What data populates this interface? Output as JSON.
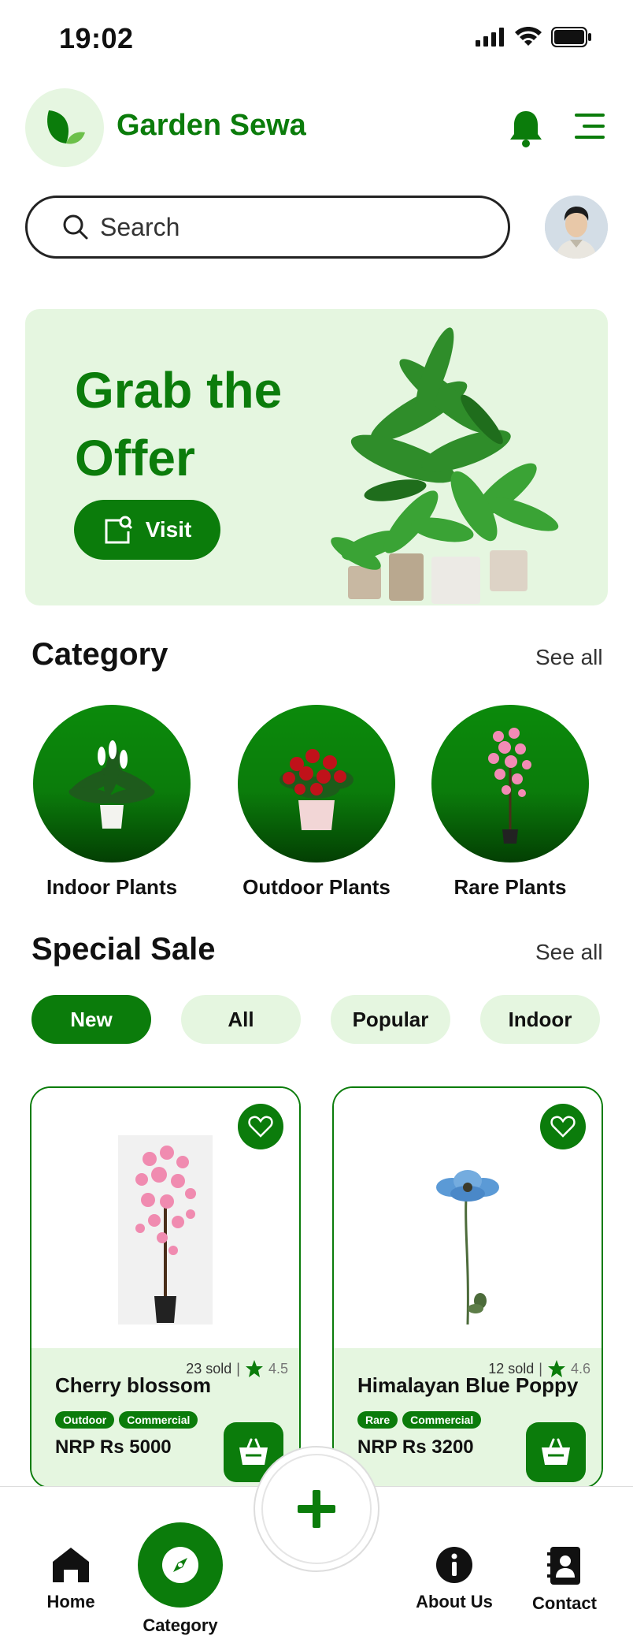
{
  "status_bar": {
    "time": "19:02"
  },
  "header": {
    "brand": "Garden Sewa"
  },
  "search": {
    "placeholder": "Search"
  },
  "banner": {
    "title": "Grab the Offer",
    "button_label": "Visit"
  },
  "category": {
    "title": "Category",
    "see_all": "See all",
    "items": [
      {
        "label": "Indoor Plants"
      },
      {
        "label": "Outdoor Plants"
      },
      {
        "label": "Rare Plants"
      }
    ]
  },
  "special_sale": {
    "title": "Special Sale",
    "see_all": "See all",
    "filters": [
      {
        "label": "New",
        "active": true
      },
      {
        "label": "All",
        "active": false
      },
      {
        "label": "Popular",
        "active": false
      },
      {
        "label": "Indoor",
        "active": false
      }
    ],
    "products": [
      {
        "name": "Cherry blossom",
        "sold": "23 sold",
        "rating": "4.5",
        "tags": [
          "Outdoor",
          "Commercial"
        ],
        "price": "NRP Rs 5000"
      },
      {
        "name": "Himalayan Blue Poppy",
        "sold": "12 sold",
        "rating": "4.6",
        "tags": [
          "Rare",
          "Commercial"
        ],
        "price": "NRP Rs 3200"
      }
    ]
  },
  "bottom_nav": {
    "items": [
      {
        "label": "Home"
      },
      {
        "label": "Category"
      },
      {
        "label": "About Us"
      },
      {
        "label": "Contact"
      }
    ]
  },
  "colors": {
    "brand_green": "#0b7c0b",
    "light_green": "#e5f6e0"
  },
  "icons": [
    "leaf-logo-icon",
    "bell-icon",
    "menu-icon",
    "search-icon",
    "visit-icon",
    "heart-icon",
    "star-icon",
    "cart-icon",
    "plus-icon",
    "home-icon",
    "compass-icon",
    "info-icon",
    "contact-icon"
  ]
}
